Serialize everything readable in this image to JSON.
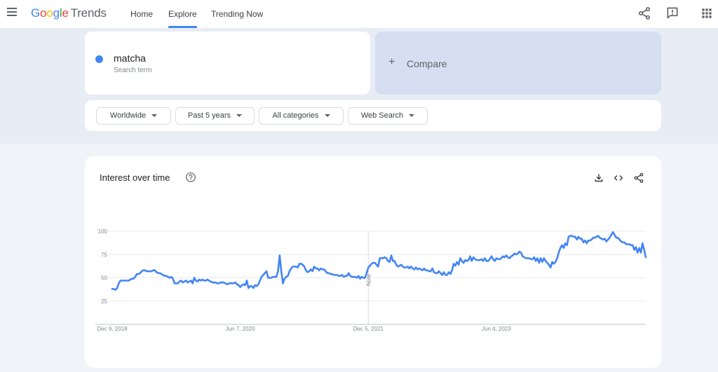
{
  "header": {
    "logo": {
      "google": [
        "G",
        "o",
        "o",
        "g",
        "l",
        "e"
      ],
      "product": "Trends"
    },
    "nav": [
      {
        "label": "Home",
        "active": false
      },
      {
        "label": "Explore",
        "active": true
      },
      {
        "label": "Trending Now",
        "active": false
      }
    ],
    "icons": [
      "share-icon",
      "feedback-icon",
      "apps-grid-icon"
    ]
  },
  "search": {
    "term": "matcha",
    "term_subtitle": "Search term",
    "term_color": "#4285f4",
    "compare_label": "Compare",
    "compare_icon": "+"
  },
  "filters": [
    {
      "label": "Worldwide"
    },
    {
      "label": "Past 5 years"
    },
    {
      "label": "All categories"
    },
    {
      "label": "Web Search"
    }
  ],
  "chart_panel": {
    "title": "Interest over time",
    "actions": [
      "download-icon",
      "embed-code-icon",
      "share-icon"
    ]
  },
  "chart_data": {
    "type": "line",
    "title": "Interest over time",
    "series": [
      {
        "name": "matcha",
        "color": "#4285f4"
      }
    ],
    "x_tick_labels": [
      "Dec 9, 2018",
      "Jun 7, 2020",
      "Dec 5, 2021",
      "Jun 4, 2023"
    ],
    "x_tick_index": [
      0,
      78,
      156,
      234
    ],
    "y_ticks": [
      25,
      50,
      75,
      100
    ],
    "ylim": [
      0,
      100
    ],
    "grid": true,
    "annotation": {
      "label": "Note",
      "index": 156
    },
    "values": [
      38,
      38,
      37,
      39,
      44,
      47,
      47,
      47,
      47,
      47,
      47,
      48,
      49,
      49,
      51,
      54,
      54,
      55,
      57,
      58,
      58,
      57,
      57,
      57,
      57,
      58,
      58,
      56,
      55,
      55,
      54,
      53,
      52,
      52,
      51,
      50,
      51,
      49,
      44,
      44,
      44,
      46,
      47,
      45,
      46,
      47,
      45,
      46,
      47,
      44,
      50,
      47,
      46,
      48,
      47,
      48,
      47,
      47,
      48,
      47,
      46,
      45,
      45,
      45,
      44,
      44,
      45,
      45,
      45,
      44,
      43,
      44,
      44,
      44,
      44,
      45,
      43,
      42,
      40,
      42,
      43,
      42,
      47,
      39,
      41,
      41,
      39,
      42,
      41,
      43,
      47,
      51,
      53,
      55,
      57,
      50,
      50,
      50,
      51,
      51,
      51,
      57,
      74,
      57,
      44,
      49,
      51,
      52,
      57,
      60,
      62,
      62,
      62,
      61,
      65,
      65,
      64,
      62,
      58,
      56,
      57,
      59,
      57,
      62,
      60,
      60,
      58,
      60,
      59,
      59,
      57,
      55,
      55,
      54,
      54,
      53,
      53,
      53,
      52,
      52,
      53,
      51,
      52,
      52,
      55,
      52,
      51,
      51,
      51,
      50,
      52,
      49,
      51,
      50,
      50,
      55,
      61,
      63,
      65,
      66,
      66,
      64,
      62,
      71,
      71,
      71,
      72,
      71,
      68,
      67,
      74,
      68,
      68,
      64,
      62,
      63,
      64,
      62,
      61,
      61,
      62,
      60,
      62,
      60,
      59,
      61,
      59,
      60,
      59,
      58,
      60,
      58,
      58,
      57,
      57,
      60,
      56,
      55,
      55,
      57,
      55,
      53,
      56,
      53,
      53,
      56,
      54,
      58,
      65,
      63,
      67,
      64,
      71,
      68,
      66,
      69,
      68,
      69,
      73,
      68,
      72,
      70,
      69,
      69,
      69,
      70,
      68,
      71,
      68,
      68,
      70,
      73,
      70,
      68,
      71,
      70,
      70,
      71,
      73,
      72,
      74,
      72,
      71,
      73,
      74,
      76,
      75,
      76,
      78,
      77,
      73,
      72,
      71,
      71,
      71,
      70,
      70,
      72,
      68,
      71,
      66,
      71,
      67,
      71,
      68,
      66,
      64,
      61,
      67,
      65,
      67,
      71,
      77,
      82,
      85,
      82,
      87,
      85,
      94,
      95,
      95,
      94,
      94,
      91,
      94,
      92,
      92,
      88,
      90,
      87,
      90,
      90,
      91,
      93,
      93,
      94,
      95,
      93,
      92,
      91,
      92,
      89,
      91,
      93,
      96,
      99,
      96,
      93,
      93,
      91,
      89,
      88,
      88,
      86,
      86,
      86,
      85,
      85,
      80,
      83,
      77,
      82,
      77,
      87,
      80,
      72
    ]
  }
}
